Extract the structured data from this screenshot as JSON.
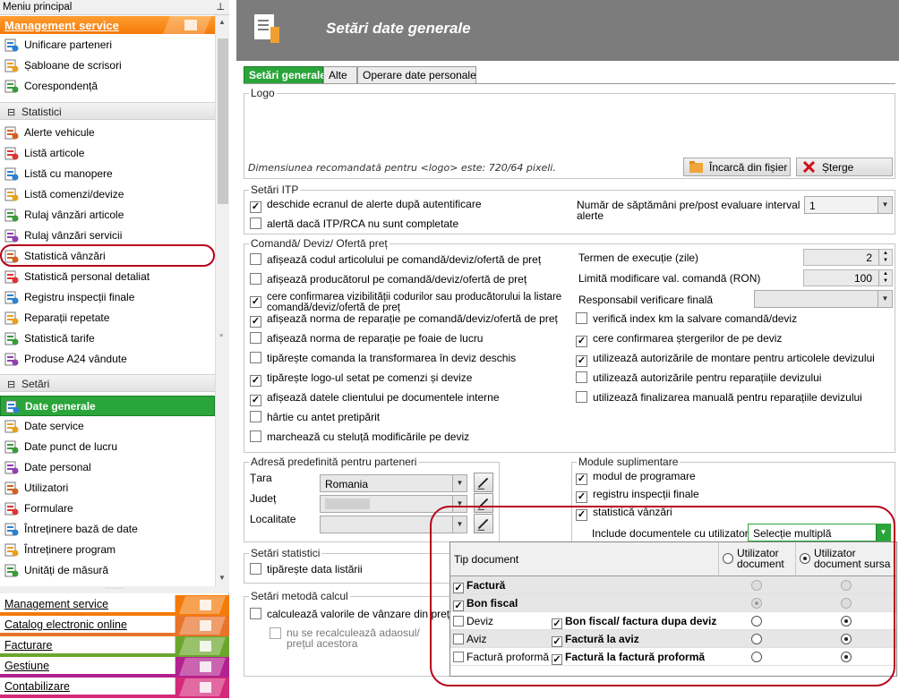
{
  "sidebar": {
    "title": "Meniu principal",
    "pin_icon": "pin-icon",
    "section_management": "Management service",
    "management_items": [
      {
        "label": "Unificare parteneri",
        "icon": "merge-icon"
      },
      {
        "label": "Șabloane de scrisori",
        "icon": "letter-template-icon"
      },
      {
        "label": "Corespondență",
        "icon": "mail-icon"
      }
    ],
    "section_statistici": "Statistici",
    "statistici_items": [
      {
        "label": "Alerte vehicule",
        "icon": "alert-list-icon"
      },
      {
        "label": "Listă articole",
        "icon": "search-icon"
      },
      {
        "label": "Listă cu manopere",
        "icon": "wrench-icon"
      },
      {
        "label": "Listă comenzi/devize",
        "icon": "document-list-icon"
      },
      {
        "label": "Rulaj vânzări articole",
        "icon": "bar-chart-icon"
      },
      {
        "label": "Rulaj vânzări servicii",
        "icon": "bar-chart-icon"
      },
      {
        "label": "Statistică vânzări",
        "icon": "statistic-icon"
      },
      {
        "label": "Statistică personal detaliat",
        "icon": "person-chart-icon"
      },
      {
        "label": "Registru inspecții finale",
        "icon": "register-icon"
      },
      {
        "label": "Reparații repetate",
        "icon": "repeat-icon"
      },
      {
        "label": "Statistică tarife",
        "icon": "tariff-icon"
      },
      {
        "label": "Produse A24 vândute",
        "icon": "a24-icon"
      }
    ],
    "section_setari": "Setări",
    "setari_items": [
      {
        "label": "Date generale",
        "icon": "settings-doc-icon"
      },
      {
        "label": "Date service",
        "icon": "service-doc-icon"
      },
      {
        "label": "Date punct de lucru",
        "icon": "workplace-icon"
      },
      {
        "label": "Date personal",
        "icon": "person-icon"
      },
      {
        "label": "Utilizatori",
        "icon": "users-icon"
      },
      {
        "label": "Formulare",
        "icon": "form-icon"
      },
      {
        "label": "Întreținere bază de date",
        "icon": "database-icon"
      },
      {
        "label": "Întreținere program",
        "icon": "program-icon"
      },
      {
        "label": "Unități de măsură",
        "icon": "ruler-icon"
      }
    ],
    "bottom_categories": [
      {
        "label": "Management service",
        "color": "#f47a0a"
      },
      {
        "label": "Catalog electronic online",
        "color": "#e8732a"
      },
      {
        "label": "Facturare",
        "color": "#6aa62c"
      },
      {
        "label": "Gestiune",
        "color": "#b3218f"
      },
      {
        "label": "Contabilizare",
        "color": "#d42a7a"
      }
    ]
  },
  "header": {
    "title": "Setări date generale",
    "icon": "settings-document-icon"
  },
  "tabs": [
    "Setări generale",
    "Alte",
    "Operare date personale"
  ],
  "logo": {
    "title": "Logo",
    "hint": "Dimensiunea recomandată pentru <logo> este: 720/64 pixeli.",
    "load_button": "Încarcă din fișier",
    "delete_button": "Șterge"
  },
  "itp": {
    "title": "Setări ITP",
    "opt1": "deschide ecranul de alerte după autentificare",
    "opt2": "alertă dacă ITP/RCA nu sunt completate",
    "weeks_label": "Număr de săptămâni pre/post evaluare interval alerte",
    "weeks_value": "1"
  },
  "comanda": {
    "title": "Comandă/ Deviz/ Ofertă preț",
    "left_opts": [
      {
        "label": "afișează codul articolului pe comandă/deviz/ofertă de preț",
        "checked": false
      },
      {
        "label": "afișează producătorul pe comandă/deviz/ofertă de preț",
        "checked": false
      },
      {
        "label": "cere confirmarea vizibilității codurilor sau producătorului la listare comandă/deviz/ofertă de preț",
        "checked": true
      },
      {
        "label": "afișează norma de reparație pe comandă/deviz/ofertă de preț",
        "checked": true
      },
      {
        "label": "afișează norma de reparație pe foaie de lucru",
        "checked": false
      },
      {
        "label": "tipărește comanda la transformarea în deviz deschis",
        "checked": false
      },
      {
        "label": "tipărește logo-ul setat pe comenzi și devize",
        "checked": true
      },
      {
        "label": "afișează datele clientului pe documentele interne",
        "checked": true
      },
      {
        "label": "hârtie cu antet pretipărit",
        "checked": false
      },
      {
        "label": "marchează cu steluță modificările pe deviz",
        "checked": false
      }
    ],
    "termen_label": "Termen de execuție (zile)",
    "termen_value": "2",
    "limita_label": "Limită modificare val. comandă (RON)",
    "limita_value": "100",
    "responsabil_label": "Responsabil verificare finală",
    "right_opts": [
      {
        "label": "verifică index km la salvare comandă/deviz",
        "checked": false
      },
      {
        "label": "cere confirmarea ștergerilor de pe deviz",
        "checked": true
      },
      {
        "label": "utilizează autorizările de montare pentru articolele devizului",
        "checked": true
      },
      {
        "label": "utilizează autorizările pentru reparațiile devizului",
        "checked": false
      },
      {
        "label": "utilizează finalizarea manuală pentru reparațiile devizului",
        "checked": false
      }
    ]
  },
  "adresa": {
    "title": "Adresă predefinită pentru parteneri",
    "tara_label": "Țara",
    "tara_value": "Romania",
    "judet_label": "Județ",
    "localitate_label": "Localitate"
  },
  "statistici_settings": {
    "title": "Setări statistici",
    "opt": "tipărește data listării"
  },
  "metoda": {
    "title": "Setări metodă calcul",
    "opt1": "calculează valorile de vânzare din prețul",
    "opt2": "nu se recalculează adaosul/ prețul acestora"
  },
  "module": {
    "title": "Module suplimentare",
    "opts": [
      {
        "label": "modul de programare",
        "checked": true
      },
      {
        "label": "registru inspecții finale",
        "checked": true
      },
      {
        "label": "statistică vânzări",
        "checked": true
      }
    ],
    "include_label": "Include documentele cu utilizatorii",
    "include_value": "Selecție multiplă"
  },
  "grid": {
    "col_tip": "Tip document",
    "col_util_doc": "Utilizator document",
    "col_util_sursa": "Utilizator document sursa",
    "rows": [
      {
        "left": "Factură",
        "left_checked": true,
        "left_bold": true,
        "right": "",
        "right_checked": false,
        "r1": false,
        "r2": false,
        "disabled": true,
        "gray": true
      },
      {
        "left": "Bon fiscal",
        "left_checked": true,
        "left_bold": true,
        "right": "",
        "right_checked": false,
        "r1": true,
        "r2": false,
        "disabled": true,
        "gray": true
      },
      {
        "left": "Deviz",
        "left_checked": false,
        "left_bold": false,
        "right": "Bon fiscal/ factura dupa deviz",
        "right_checked": true,
        "r1": false,
        "r2": true,
        "disabled": false,
        "gray": false
      },
      {
        "left": "Aviz",
        "left_checked": false,
        "left_bold": false,
        "right": "Factură la aviz",
        "right_checked": true,
        "r1": false,
        "r2": true,
        "disabled": false,
        "gray": true
      },
      {
        "left": "Factură proformă",
        "left_checked": false,
        "left_bold": false,
        "right": "Factură la factură proformă",
        "right_checked": true,
        "r1": false,
        "r2": true,
        "disabled": false,
        "gray": false
      }
    ]
  }
}
